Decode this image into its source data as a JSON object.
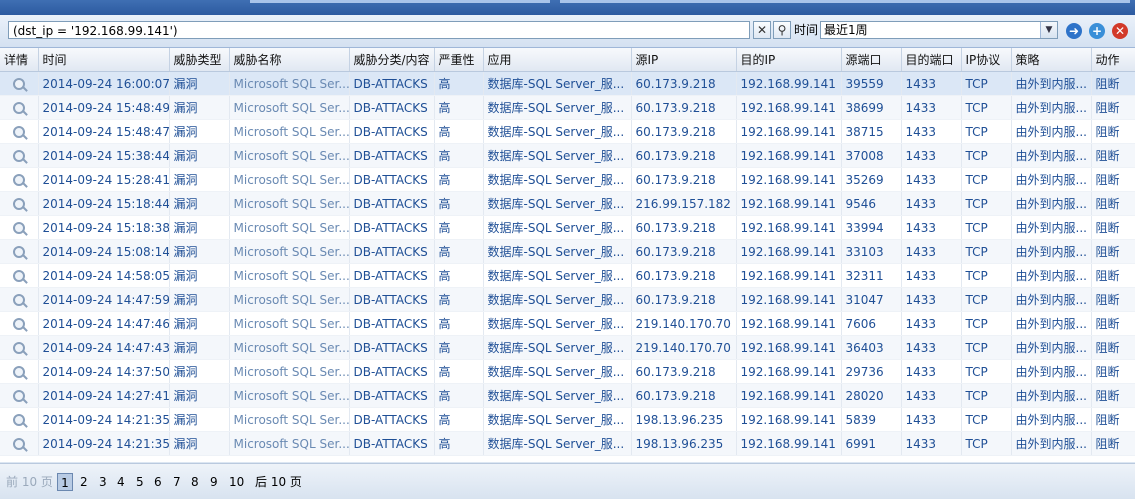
{
  "search": {
    "query": "(dst_ip = '192.168.99.141')",
    "time_label": "时间",
    "time_value": "最近1周"
  },
  "icons": {
    "clear": "close-icon",
    "search": "search-icon",
    "dropdown": "chevron-down-icon",
    "go": "arrow-right-icon",
    "add": "add-icon",
    "remove": "remove-icon"
  },
  "table": {
    "columns": [
      "详情",
      "时间",
      "威胁类型",
      "威胁名称",
      "威胁分类/内容",
      "严重性",
      "应用",
      "源IP",
      "目的IP",
      "源端口",
      "目的端口",
      "IP协议",
      "策略",
      "动作"
    ],
    "rows": [
      [
        "2014-09-24 16:00:07",
        "漏洞",
        "Microsoft SQL Ser...",
        "DB-ATTACKS",
        "高",
        "数据库-SQL Server_服...",
        "60.173.9.218",
        "192.168.99.141",
        "39559",
        "1433",
        "TCP",
        "由外到内服...",
        "阻断"
      ],
      [
        "2014-09-24 15:48:49",
        "漏洞",
        "Microsoft SQL Ser...",
        "DB-ATTACKS",
        "高",
        "数据库-SQL Server_服...",
        "60.173.9.218",
        "192.168.99.141",
        "38699",
        "1433",
        "TCP",
        "由外到内服...",
        "阻断"
      ],
      [
        "2014-09-24 15:48:47",
        "漏洞",
        "Microsoft SQL Ser...",
        "DB-ATTACKS",
        "高",
        "数据库-SQL Server_服...",
        "60.173.9.218",
        "192.168.99.141",
        "38715",
        "1433",
        "TCP",
        "由外到内服...",
        "阻断"
      ],
      [
        "2014-09-24 15:38:44",
        "漏洞",
        "Microsoft SQL Ser...",
        "DB-ATTACKS",
        "高",
        "数据库-SQL Server_服...",
        "60.173.9.218",
        "192.168.99.141",
        "37008",
        "1433",
        "TCP",
        "由外到内服...",
        "阻断"
      ],
      [
        "2014-09-24 15:28:41",
        "漏洞",
        "Microsoft SQL Ser...",
        "DB-ATTACKS",
        "高",
        "数据库-SQL Server_服...",
        "60.173.9.218",
        "192.168.99.141",
        "35269",
        "1433",
        "TCP",
        "由外到内服...",
        "阻断"
      ],
      [
        "2014-09-24 15:18:44",
        "漏洞",
        "Microsoft SQL Ser...",
        "DB-ATTACKS",
        "高",
        "数据库-SQL Server_服...",
        "216.99.157.182",
        "192.168.99.141",
        "9546",
        "1433",
        "TCP",
        "由外到内服...",
        "阻断"
      ],
      [
        "2014-09-24 15:18:38",
        "漏洞",
        "Microsoft SQL Ser...",
        "DB-ATTACKS",
        "高",
        "数据库-SQL Server_服...",
        "60.173.9.218",
        "192.168.99.141",
        "33994",
        "1433",
        "TCP",
        "由外到内服...",
        "阻断"
      ],
      [
        "2014-09-24 15:08:14",
        "漏洞",
        "Microsoft SQL Ser...",
        "DB-ATTACKS",
        "高",
        "数据库-SQL Server_服...",
        "60.173.9.218",
        "192.168.99.141",
        "33103",
        "1433",
        "TCP",
        "由外到内服...",
        "阻断"
      ],
      [
        "2014-09-24 14:58:05",
        "漏洞",
        "Microsoft SQL Ser...",
        "DB-ATTACKS",
        "高",
        "数据库-SQL Server_服...",
        "60.173.9.218",
        "192.168.99.141",
        "32311",
        "1433",
        "TCP",
        "由外到内服...",
        "阻断"
      ],
      [
        "2014-09-24 14:47:59",
        "漏洞",
        "Microsoft SQL Ser...",
        "DB-ATTACKS",
        "高",
        "数据库-SQL Server_服...",
        "60.173.9.218",
        "192.168.99.141",
        "31047",
        "1433",
        "TCP",
        "由外到内服...",
        "阻断"
      ],
      [
        "2014-09-24 14:47:46",
        "漏洞",
        "Microsoft SQL Ser...",
        "DB-ATTACKS",
        "高",
        "数据库-SQL Server_服...",
        "219.140.170.70",
        "192.168.99.141",
        "7606",
        "1433",
        "TCP",
        "由外到内服...",
        "阻断"
      ],
      [
        "2014-09-24 14:47:43",
        "漏洞",
        "Microsoft SQL Ser...",
        "DB-ATTACKS",
        "高",
        "数据库-SQL Server_服...",
        "219.140.170.70",
        "192.168.99.141",
        "36403",
        "1433",
        "TCP",
        "由外到内服...",
        "阻断"
      ],
      [
        "2014-09-24 14:37:50",
        "漏洞",
        "Microsoft SQL Ser...",
        "DB-ATTACKS",
        "高",
        "数据库-SQL Server_服...",
        "60.173.9.218",
        "192.168.99.141",
        "29736",
        "1433",
        "TCP",
        "由外到内服...",
        "阻断"
      ],
      [
        "2014-09-24 14:27:41",
        "漏洞",
        "Microsoft SQL Ser...",
        "DB-ATTACKS",
        "高",
        "数据库-SQL Server_服...",
        "60.173.9.218",
        "192.168.99.141",
        "28020",
        "1433",
        "TCP",
        "由外到内服...",
        "阻断"
      ],
      [
        "2014-09-24 14:21:35",
        "漏洞",
        "Microsoft SQL Ser...",
        "DB-ATTACKS",
        "高",
        "数据库-SQL Server_服...",
        "198.13.96.235",
        "192.168.99.141",
        "5839",
        "1433",
        "TCP",
        "由外到内服...",
        "阻断"
      ],
      [
        "2014-09-24 14:21:35",
        "漏洞",
        "Microsoft SQL Ser...",
        "DB-ATTACKS",
        "高",
        "数据库-SQL Server_服...",
        "198.13.96.235",
        "192.168.99.141",
        "6991",
        "1433",
        "TCP",
        "由外到内服...",
        "阻断"
      ]
    ]
  },
  "pager": {
    "prev": "前 10 页",
    "pages": [
      "1",
      "2",
      "3",
      "4",
      "5",
      "6",
      "7",
      "8",
      "9",
      "10"
    ],
    "current": "1",
    "next": "后 10 页"
  }
}
